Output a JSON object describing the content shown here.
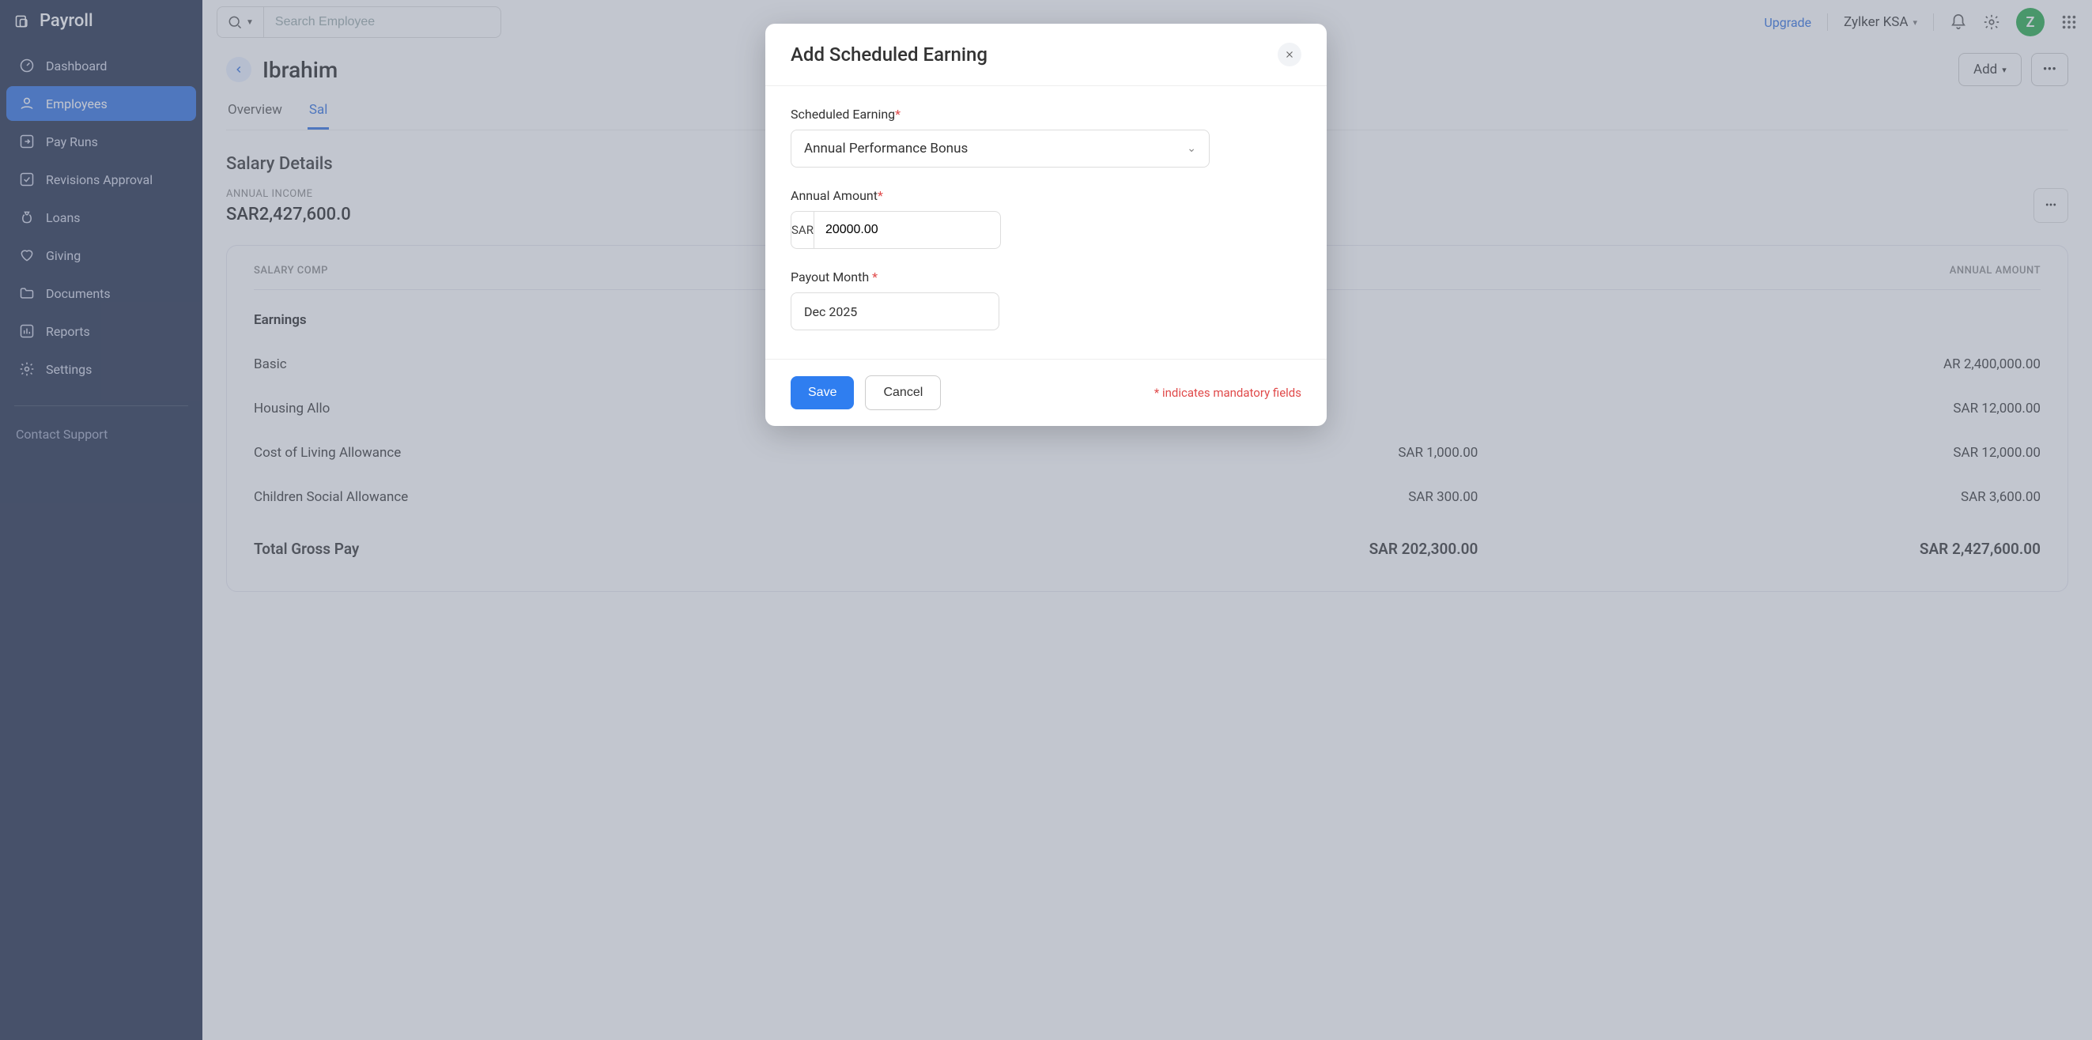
{
  "app": {
    "name": "Payroll"
  },
  "sidebar": {
    "items": [
      {
        "label": "Dashboard"
      },
      {
        "label": "Employees"
      },
      {
        "label": "Pay Runs"
      },
      {
        "label": "Revisions Approval"
      },
      {
        "label": "Loans"
      },
      {
        "label": "Giving"
      },
      {
        "label": "Documents"
      },
      {
        "label": "Reports"
      },
      {
        "label": "Settings"
      }
    ],
    "contact_support": "Contact Support"
  },
  "header": {
    "search_placeholder": "Search Employee",
    "upgrade": "Upgrade",
    "org_name": "Zylker KSA",
    "avatar_initial": "Z"
  },
  "page": {
    "employee_name": "Ibrahim",
    "add_label": "Add",
    "tabs": {
      "overview": "Overview",
      "salary": "Sal"
    },
    "section_title": "Salary Details",
    "summary": {
      "label": "ANNUAL INCOME",
      "value": "SAR2,427,600.0"
    }
  },
  "table": {
    "headers": {
      "component": "SALARY COMP",
      "monthly": "",
      "annual": "ANNUAL AMOUNT"
    },
    "group": "Earnings",
    "rows": [
      {
        "name": "Basic",
        "monthly": "",
        "annual": "AR 2,400,000.00"
      },
      {
        "name": "Housing Allo",
        "monthly": "",
        "annual": "SAR 12,000.00"
      },
      {
        "name": "Cost of Living Allowance",
        "monthly": "SAR 1,000.00",
        "annual": "SAR 12,000.00"
      },
      {
        "name": "Children Social Allowance",
        "monthly": "SAR 300.00",
        "annual": "SAR 3,600.00"
      }
    ],
    "total": {
      "label": "Total Gross Pay",
      "monthly": "SAR 202,300.00",
      "annual": "SAR 2,427,600.00"
    }
  },
  "modal": {
    "title": "Add Scheduled Earning",
    "fields": {
      "scheduled_earning": {
        "label": "Scheduled Earning",
        "value": "Annual Performance Bonus"
      },
      "annual_amount": {
        "label": "Annual Amount",
        "currency": "SAR",
        "value": "20000.00"
      },
      "payout_month": {
        "label": "Payout Month ",
        "value": "Dec 2025"
      }
    },
    "save": "Save",
    "cancel": "Cancel",
    "mandatory_note": "* indicates mandatory fields"
  }
}
